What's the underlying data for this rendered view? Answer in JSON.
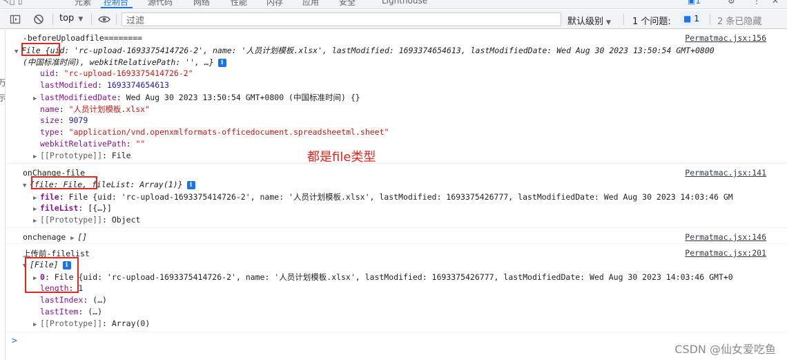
{
  "tabs": [
    "元素",
    "控制台",
    "源代码",
    "网络",
    "性能",
    "内存",
    "应用",
    "安全",
    "Lighthouse"
  ],
  "toolbar": {
    "context": "top",
    "filter_placeholder": "过滤",
    "levels": "默认级别",
    "issues_label": "1 个问题:",
    "issues_count": "1",
    "hidden": "2 条已隐藏"
  },
  "left_cut": [
    "万",
    "示"
  ],
  "messages": {
    "m1": {
      "title": "-beforeUploadfile========",
      "source": "Permatmac.jsx:156",
      "summary_a": "File",
      "summary_b": "{uid: 'rc-upload-1693375414726-2', name: '人员计划模板.xlsx', lastModified: 1693374654613, lastModifiedDate: Wed Aug 30 2023 13:50:54 GMT+0800",
      "summary_c": "(中国标准时间), webkitRelativePath: '', …}",
      "props": [
        {
          "key": "uid",
          "val": "\"rc-upload-1693375414726-2\"",
          "kind": "str"
        },
        {
          "key": "lastModified",
          "val": "1693374654613",
          "kind": "num"
        },
        {
          "key": "lastModifiedDate",
          "val": "Wed Aug 30 2023 13:50:54 GMT+0800 (中国标准时间) {}",
          "kind": "dark",
          "expand": true
        },
        {
          "key": "name",
          "val": "\"人员计划模板.xlsx\"",
          "kind": "str"
        },
        {
          "key": "size",
          "val": "9079",
          "kind": "num"
        },
        {
          "key": "type",
          "val": "\"application/vnd.openxmlformats-officedocument.spreadsheetml.sheet\"",
          "kind": "str"
        },
        {
          "key": "webkitRelativePath",
          "val": "\"\"",
          "kind": "str"
        },
        {
          "key": "[[Prototype]]",
          "val": "File",
          "kind": "dark",
          "expand": true
        }
      ]
    },
    "m2": {
      "title": "onChange-file",
      "source": "Permatmac.jsx:141",
      "summary": "{file: File, fileList: Array(1)}",
      "file_key": "file",
      "file_val": "File {uid: 'rc-upload-1693375414726-2', name: '人员计划模板.xlsx', lastModified: 1693375426777, lastModifiedDate: Wed Aug 30 2023 14:03:46 GM",
      "filelist_key": "fileList",
      "filelist_val": "[{…}]",
      "proto_key": "[[Prototype]]",
      "proto_val": "Object"
    },
    "m3": {
      "title": "onchenage",
      "value": "[]",
      "source": "Permatmac.jsx:146"
    },
    "m4": {
      "title": "上传前-filelist",
      "source": "Permatmac.jsx:201",
      "summary": "[File]",
      "item_key": "0",
      "item_val_a": "File",
      "item_val_b": "{uid: 'rc-upload-1693375414726-2', name: '人员计划模板.xlsx', lastModified: 1693375426777, lastModifiedDate: Wed Aug 30 2023 14:03:46 GMT+0",
      "length_key": "length",
      "length_val": "1",
      "lastindex_key": "lastIndex",
      "lastindex_val": "(…)",
      "lastitem_key": "lastItem",
      "lastitem_val": "(…)",
      "proto_key": "[[Prototype]]",
      "proto_val": "Array(0)"
    }
  },
  "annotation": "都是file类型",
  "prompt": ">",
  "watermark": "CSDN @仙女爱吃鱼",
  "colors": {
    "accent": "#1a73e8",
    "highlight": "#e8241c"
  }
}
